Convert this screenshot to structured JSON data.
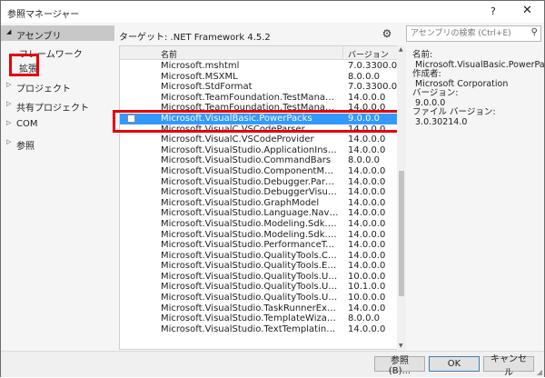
{
  "window": {
    "title": "参照マネージャー",
    "help": "?",
    "close": "✕"
  },
  "nav": {
    "header": "アセンブリ",
    "sub_items": [
      "フレームワーク",
      "拡張"
    ],
    "items": [
      "プロジェクト",
      "共有プロジェクト",
      "COM",
      "参照"
    ]
  },
  "toolbar": {
    "target": "ターゲット: .NET Framework 4.5.2",
    "search_placeholder": "アセンブリの検索 (Ctrl+E)"
  },
  "list": {
    "col_name": "名前",
    "col_version": "バージョン",
    "rows": [
      {
        "name": "Microsoft.mshtml",
        "version": "7.0.3300.0"
      },
      {
        "name": "Microsoft.MSXML",
        "version": "8.0.0.0"
      },
      {
        "name": "Microsoft.StdFormat",
        "version": "7.0.3300.0"
      },
      {
        "name": "Microsoft.TeamFoundation.TestManagement.C...",
        "version": "14.0.0.0"
      },
      {
        "name": "Microsoft.TeamFoundation.TestManagement.C...",
        "version": "14.0.0.0"
      },
      {
        "name": "Microsoft.VisualBasic.PowerPacks",
        "version": "9.0.0.0"
      },
      {
        "name": "Microsoft.VisualC.VSCodeParser",
        "version": "14.0.0.0"
      },
      {
        "name": "Microsoft.VisualC.VSCodeProvider",
        "version": "14.0.0.0"
      },
      {
        "name": "Microsoft.VisualStudio.ApplicationInsights.Int...",
        "version": "14.0.0.0"
      },
      {
        "name": "Microsoft.VisualStudio.CommandBars",
        "version": "8.0.0.0"
      },
      {
        "name": "Microsoft.VisualStudio.ComponentModelHost",
        "version": "14.0.0.0"
      },
      {
        "name": "Microsoft.VisualStudio.Debugger.Parallel.Multi...",
        "version": "14.0.0.0"
      },
      {
        "name": "Microsoft.VisualStudio.DebuggerVisualizers",
        "version": "14.0.0.0"
      },
      {
        "name": "Microsoft.VisualStudio.GraphModel",
        "version": "14.0.0.0"
      },
      {
        "name": "Microsoft.VisualStudio.Language.NavigateTo.I...",
        "version": "14.0.0.0"
      },
      {
        "name": "Microsoft.VisualStudio.Modeling.Sdk.Integrati...",
        "version": "14.0.0.0"
      },
      {
        "name": "Microsoft.VisualStudio.Modeling.Sdk.Integrati...",
        "version": "14.0.0.0"
      },
      {
        "name": "Microsoft.VisualStudio.PerformanceTools.Auto...",
        "version": "14.0.0.0"
      },
      {
        "name": "Microsoft.VisualStudio.QualityTools.Common",
        "version": "14.0.0.0"
      },
      {
        "name": "Microsoft.VisualStudio.QualityTools.Execution...",
        "version": "14.0.0.0"
      },
      {
        "name": "Microsoft.VisualStudio.QualityTools.UnitTestFr...",
        "version": "10.0.0.0"
      },
      {
        "name": "Microsoft.VisualStudio.QualityTools.UnitTestFr...",
        "version": "10.1.0.0"
      },
      {
        "name": "Microsoft.VisualStudio.QualityTools.UnitTestFr...",
        "version": "10.0.0.0"
      },
      {
        "name": "Microsoft.VisualStudio.TaskRunnerExplorer.14.0",
        "version": "14.0.0.0"
      },
      {
        "name": "Microsoft.VisualStudio.TemplateWizardInterface",
        "version": "8.0.0.0"
      },
      {
        "name": "Microsoft.VisualStudio.TextTemplating.Modeli...",
        "version": "14.0.0.0"
      }
    ],
    "selected_index": 5,
    "scroll_position": 0.41
  },
  "details": {
    "name_label": "名前:",
    "name_value": "Microsoft.VisualBasic.PowerPacks",
    "author_label": "作成者:",
    "author_value": "Microsoft Corporation",
    "version_label": "バージョン:",
    "version_value": "9.0.0.0",
    "file_version_label": "ファイル バージョン:",
    "file_version_value": "3.0.30214.0"
  },
  "footer": {
    "browse": "参照(B)...",
    "ok": "OK",
    "cancel": "キャンセル"
  },
  "colors": {
    "selection": "#3399ff",
    "highlight_box": "#e5000b",
    "nav_selected": "#c8c8c8"
  }
}
